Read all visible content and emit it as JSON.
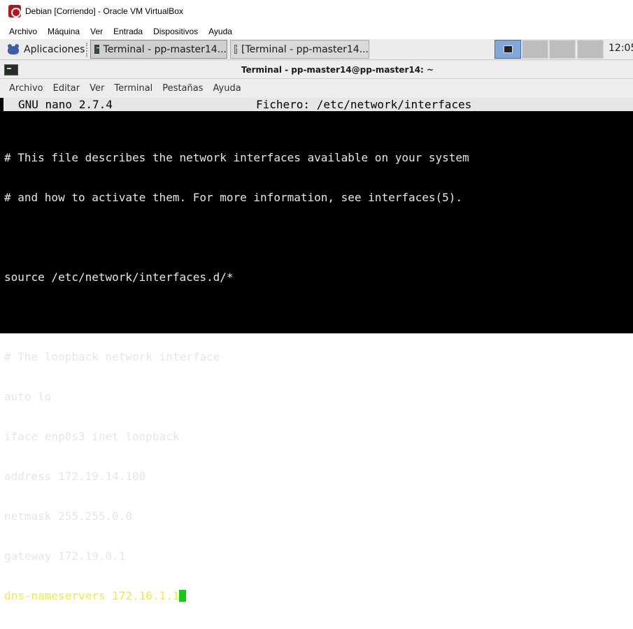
{
  "vbox": {
    "title": "Debian [Corriendo] - Oracle VM VirtualBox",
    "menu": [
      "Archivo",
      "Máquina",
      "Ver",
      "Entrada",
      "Dispositivos",
      "Ayuda"
    ]
  },
  "panel": {
    "apps_label": "Aplicaciones",
    "tasks": [
      {
        "label": "Terminal - pp-master14...",
        "icon": "terminal-icon",
        "active": true
      },
      {
        "label": "[Terminal - pp-master14...",
        "icon": "terminal-icon",
        "active": false
      }
    ],
    "workspaces": [
      {
        "active": true
      },
      {
        "active": false
      },
      {
        "active": false
      },
      {
        "active": false
      }
    ],
    "clock": "12:05",
    "colors": {
      "active_workspace": "#7fa7d8",
      "panel_bg": "#ececec"
    }
  },
  "terminal": {
    "title": "Terminal - pp-master14@pp-master14: ~",
    "menu": [
      "Archivo",
      "Editar",
      "Ver",
      "Terminal",
      "Pestañas",
      "Ayuda"
    ],
    "nano": {
      "version": "GNU nano 2.7.4",
      "file": "Fichero: /etc/network/interfaces"
    },
    "lines": [
      "# This file describes the network interfaces available on your system",
      "# and how to activate them. For more information, see interfaces(5).",
      "",
      "source /etc/network/interfaces.d/*",
      "",
      "# The loopback network interface",
      "auto lo",
      "iface enp0s3 inet loopback",
      "address 172.19.14.100",
      "netmask 255.255.0.0",
      "gateway 172.19.0.1",
      "dns-nameservers 172.16.1.1"
    ],
    "colors": {
      "text": "#e6e6e6",
      "highlight_line": "#eded3a",
      "cursor": "#18c718",
      "background": "#000000"
    }
  }
}
